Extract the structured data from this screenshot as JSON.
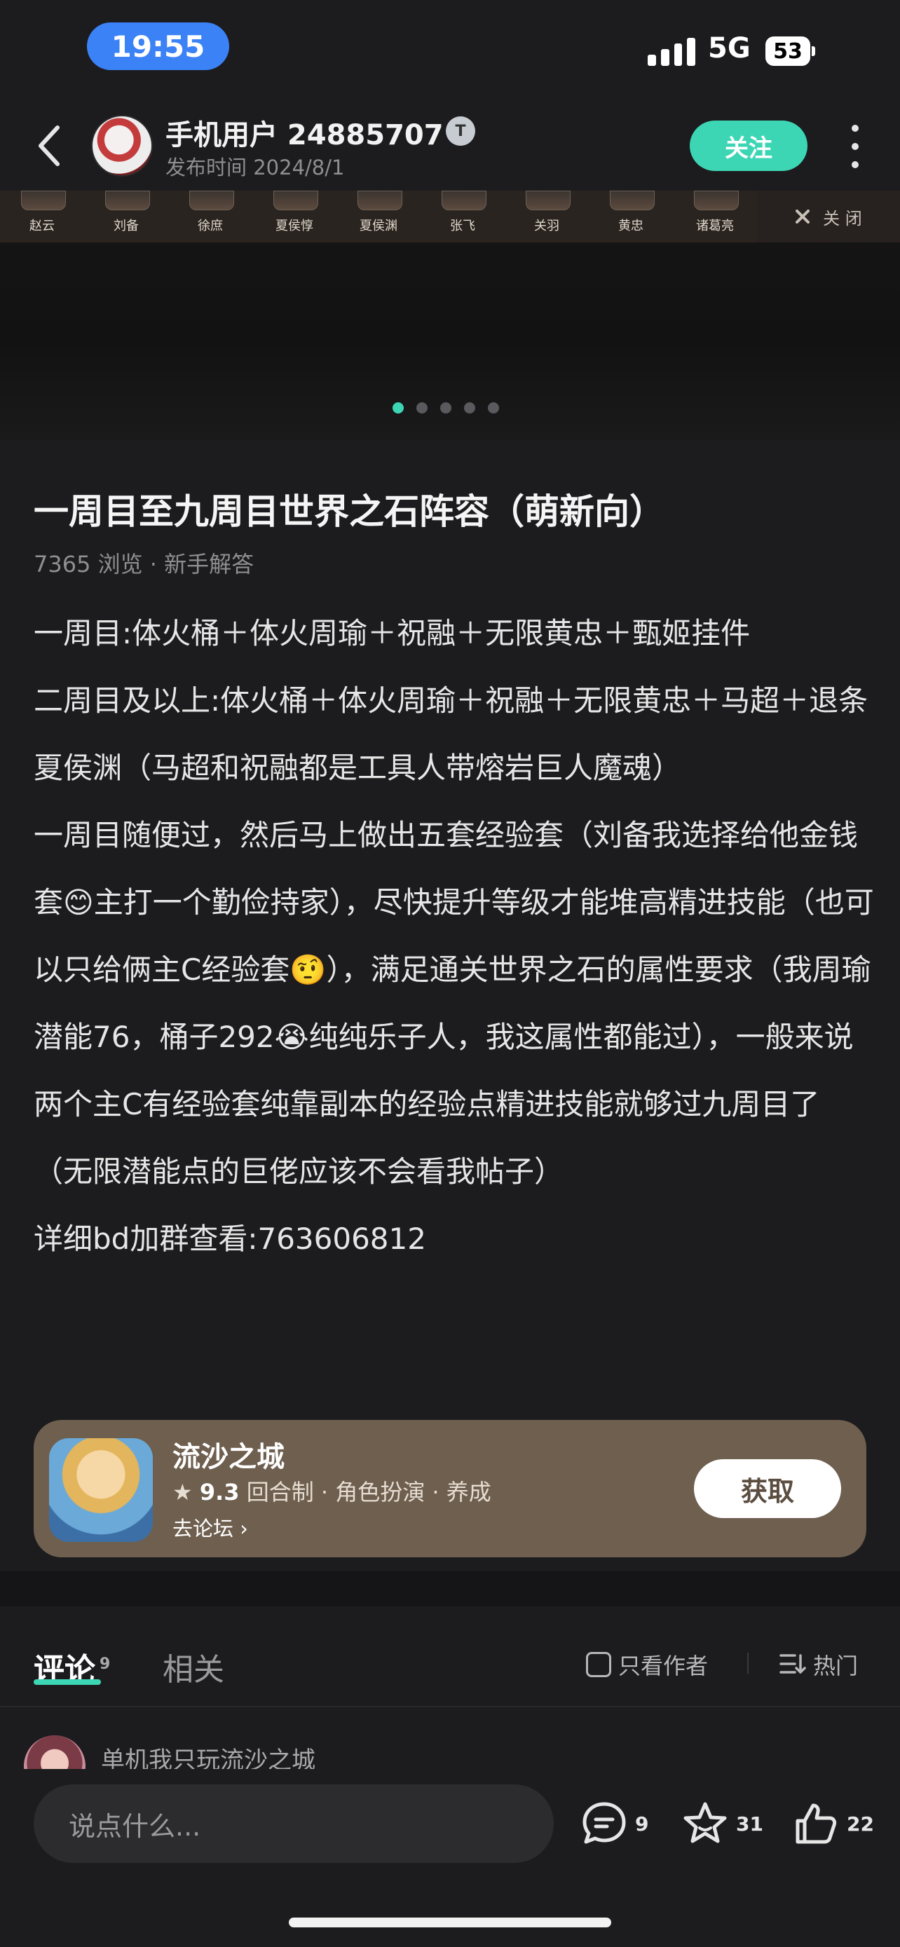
{
  "status_bar": {
    "time": "19:55",
    "network": "5G",
    "battery": "53"
  },
  "header": {
    "username": "手机用户 24885707",
    "badge": "T",
    "publish_time": "发布时间 2024/8/1",
    "follow_label": "关注"
  },
  "hero_strip": {
    "heroes": [
      "赵云",
      "刘备",
      "徐庶",
      "夏侯惇",
      "夏侯渊",
      "张飞",
      "关羽",
      "黄忠",
      "诸葛亮"
    ],
    "close_label": "关 闭"
  },
  "carousel": {
    "dot_count": 5,
    "active_index": 0
  },
  "article": {
    "title": "一周目至九周目世界之石阵容（萌新向）",
    "meta": "7365 浏览 · 新手解答",
    "paragraphs": [
      "一周目:体火桶＋体火周瑜＋祝融＋无限黄忠＋甄姬挂件",
      "二周目及以上:体火桶＋体火周瑜＋祝融＋无限黄忠＋马超＋退条夏侯渊（马超和祝融都是工具人带熔岩巨人魔魂）",
      "一周目随便过，然后马上做出五套经验套（刘备我选择给他金钱套😊主打一个勤俭持家），尽快提升等级才能堆高精进技能（也可以只给俩主C经验套🤨），满足通关世界之石的属性要求（我周瑜潜能76，桶子292😭纯纯乐子人，我这属性都能过），一般来说两个主C有经验套纯靠副本的经验点精进技能就够过九周目了（无限潜能点的巨佬应该不会看我帖子）",
      "详细bd加群查看:763606812"
    ]
  },
  "game_card": {
    "name": "流沙之城",
    "rating": "9.3",
    "tags": "回合制 · 角色扮演 · 养成",
    "forum_link": "去论坛",
    "get_label": "获取"
  },
  "tabs": {
    "comments_label": "评论",
    "comments_count": "9",
    "related_label": "相关",
    "only_author_label": "只看作者",
    "sort_label": "热门"
  },
  "first_comment": {
    "username": "单机我只玩流沙之城"
  },
  "bottom_bar": {
    "input_placeholder": "说点什么...",
    "comment_count": "9",
    "favorite_count": "31",
    "like_count": "22"
  },
  "colors": {
    "accent": "#3dd6b5",
    "card_bg": "#6e5f4f",
    "time_pill": "#3b82f6"
  }
}
